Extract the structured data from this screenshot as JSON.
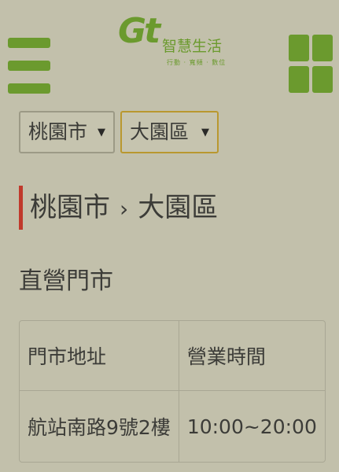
{
  "header": {
    "logo_mark": "Gt",
    "logo_name": "智慧生活",
    "logo_tagline": "行動 · 寬頻 · 數位",
    "menu_icon": "hamburger-menu-icon",
    "apps_icon": "grid-apps-icon",
    "brand_color": "#6b9a2e"
  },
  "filters": {
    "city": "桃園市",
    "district": "大園區",
    "arrow": "▼"
  },
  "breadcrumb": {
    "city": "桃園市",
    "separator": "›",
    "district": "大園區",
    "accent_color": "#c0392b"
  },
  "section": {
    "title": "直營門市"
  },
  "table": {
    "headers": [
      "門市地址",
      "營業時間"
    ],
    "rows": [
      [
        "航站南路9號2樓",
        "10:00~20:00"
      ]
    ]
  }
}
